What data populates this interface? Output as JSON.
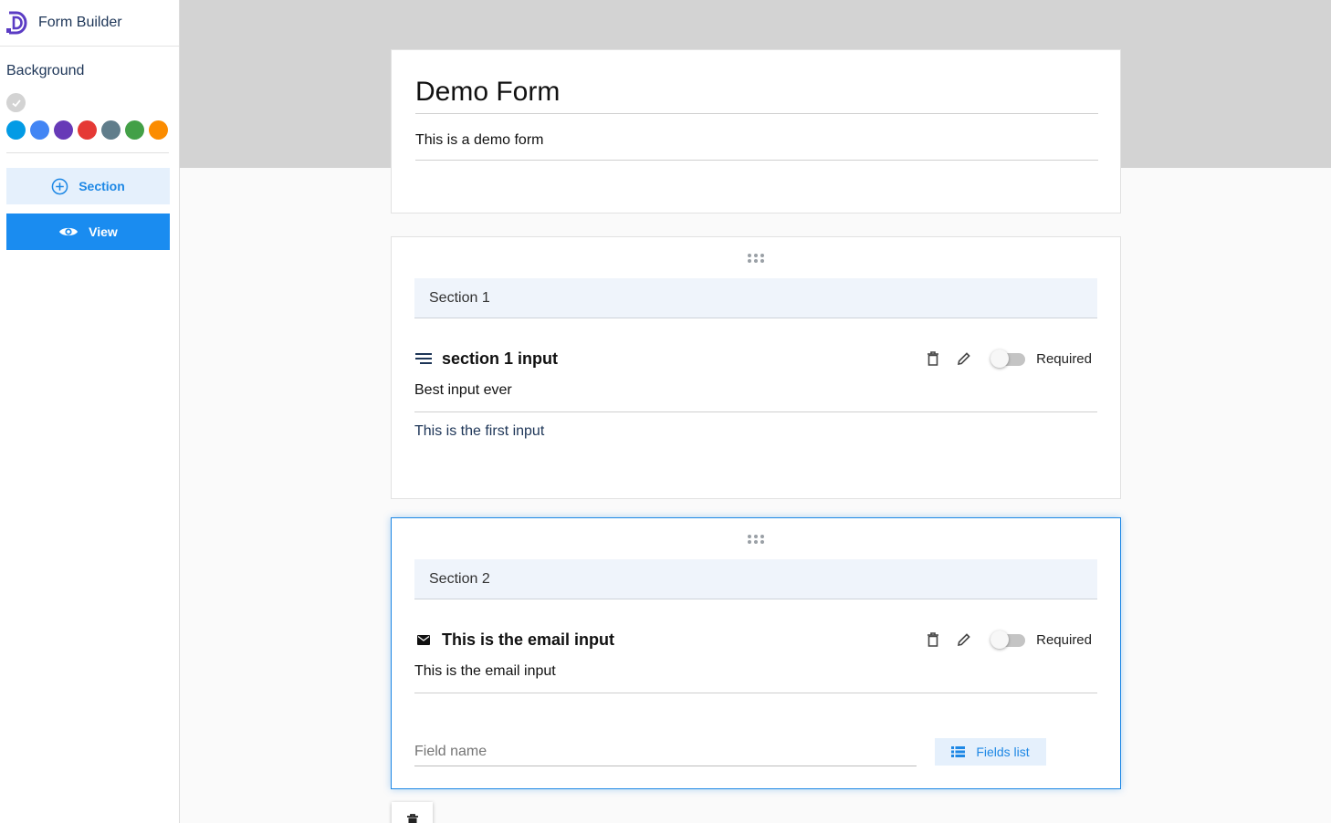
{
  "app": {
    "title": "Form Builder",
    "logo": "d-logo-icon"
  },
  "sidebar": {
    "background_label": "Background",
    "selected_swatch_color": "#d3d3d3",
    "swatch_colors": [
      "#039be5",
      "#4285f4",
      "#673ab7",
      "#e53935",
      "#607d8b",
      "#43a047",
      "#fb8c00"
    ],
    "add_section_label": "Section",
    "view_label": "View"
  },
  "form": {
    "title": "Demo Form",
    "description": "This is a demo form"
  },
  "sections": [
    {
      "header": "Section 1",
      "field": {
        "icon": "text-lines-icon",
        "title": "section 1 input",
        "value": "Best input ever",
        "description": "This is the first input",
        "required_label": "Required",
        "required": false
      }
    },
    {
      "header": "Section 2",
      "field": {
        "icon": "email-icon",
        "title": "This is the email input",
        "value": "This is the email input",
        "required_label": "Required",
        "required": false
      },
      "fieldname_placeholder": "Field name",
      "fields_list_label": "Fields list"
    }
  ],
  "colors": {
    "accent": "#1e88e5",
    "top_band": "#d3d3d3"
  }
}
